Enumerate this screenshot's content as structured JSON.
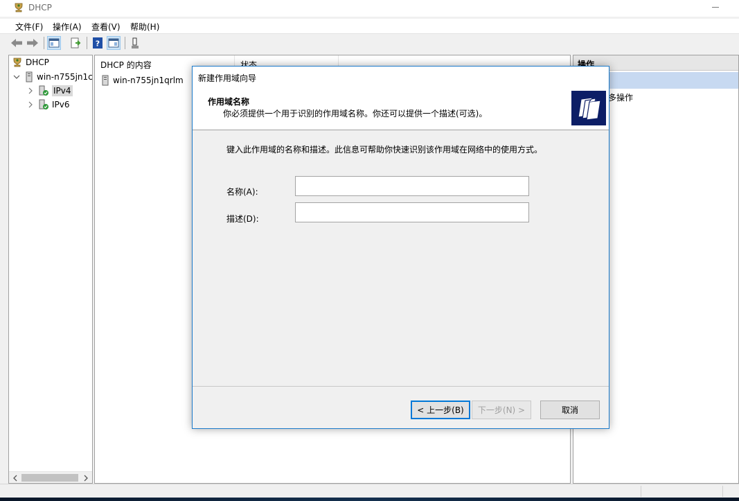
{
  "window": {
    "title": "DHCP"
  },
  "menubar": {
    "items": [
      "文件(F)",
      "操作(A)",
      "查看(V)",
      "帮助(H)"
    ]
  },
  "toolbar": {
    "icons": [
      "back-arrow-icon",
      "forward-arrow-icon",
      "console-tree-icon",
      "export-list-icon",
      "help-icon",
      "show-hide-pane-icon",
      "properties-icon"
    ]
  },
  "tree": {
    "root": "DHCP",
    "server": "win-n755jn1c",
    "ipv4": "IPv4",
    "ipv6": "IPv6"
  },
  "content": {
    "col_name": "DHCP 的内容",
    "col_status": "状态",
    "row_name": "win-n755jn1qrlm"
  },
  "actions": {
    "header": "操作",
    "more": "多操作",
    "accent": "#c7d9f1"
  },
  "dialog": {
    "title": "新建作用域向导",
    "heading": "作用域名称",
    "subheading": "你必须提供一个用于识别的作用域名称。你还可以提供一个描述(可选)。",
    "instruction": "键入此作用域的名称和描述。此信息可帮助你快速识别该作用域在网络中的使用方式。",
    "name_label": "名称(A):",
    "name_value": "",
    "desc_label": "描述(D):",
    "desc_value": "",
    "back_button": "< 上一步(B)",
    "next_button": "下一步(N) >",
    "cancel_button": "取消",
    "border_color": "#1979ca",
    "icon_bg": "#0c1e66"
  }
}
